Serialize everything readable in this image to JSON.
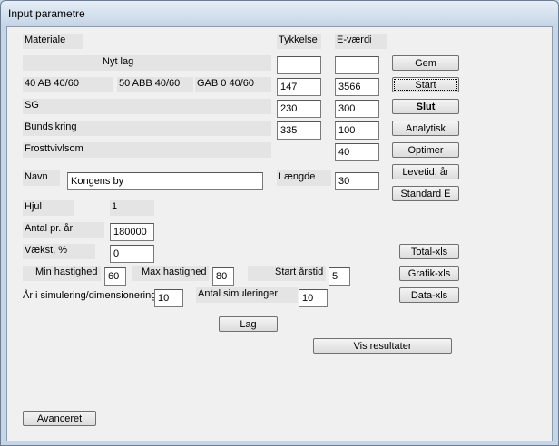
{
  "window": {
    "title": "Input parametre"
  },
  "headers": {
    "materiale": "Materiale",
    "tykkelse": "Tykkelse",
    "evaerdi": "E-værdi"
  },
  "rows": {
    "nytlag": {
      "label": "Nyt lag",
      "tykkelse": "",
      "evaerdi": ""
    },
    "asphalt": {
      "ab": "40 AB 40/60",
      "abb": "50 ABB 40/60",
      "gab": "GAB 0 40/60",
      "tykkelse": "147",
      "evaerdi": "3566"
    },
    "sg": {
      "label": "SG",
      "tykkelse": "230",
      "evaerdi": "300"
    },
    "bundsikring": {
      "label": "Bundsikring",
      "tykkelse": "335",
      "evaerdi": "100"
    },
    "frost": {
      "label": "Frosttvivlsom",
      "evaerdi": "40"
    }
  },
  "navn": {
    "label": "Navn",
    "value": "Kongens by"
  },
  "laengde": {
    "label": "Længde",
    "value": "30"
  },
  "hjul": {
    "label": "Hjul",
    "value": "1"
  },
  "antal": {
    "label": "Antal pr. år",
    "value": "180000"
  },
  "vaekst": {
    "label": "Vækst, %",
    "value": "0"
  },
  "min_hast": {
    "label": "Min hastighed",
    "value": "60"
  },
  "max_hast": {
    "label": "Max hastighed",
    "value": "80"
  },
  "start_aarstid": {
    "label": "Start årstid",
    "value": "5"
  },
  "aar_sim": {
    "label": "År i simulering/dimensionering",
    "value": "10"
  },
  "antal_sim": {
    "label": "Antal simuleringer",
    "value": "10"
  },
  "buttons": {
    "gem": "Gem",
    "start": "Start",
    "slut": "Slut",
    "analytisk": "Analytisk",
    "optimer": "Optimer",
    "levetid": "Levetid, år",
    "standard": "Standard E",
    "total": "Total-xls",
    "grafik": "Grafik-xls",
    "data": "Data-xls",
    "lag": "Lag",
    "vis": "Vis resultater",
    "avanceret": "Avanceret"
  }
}
